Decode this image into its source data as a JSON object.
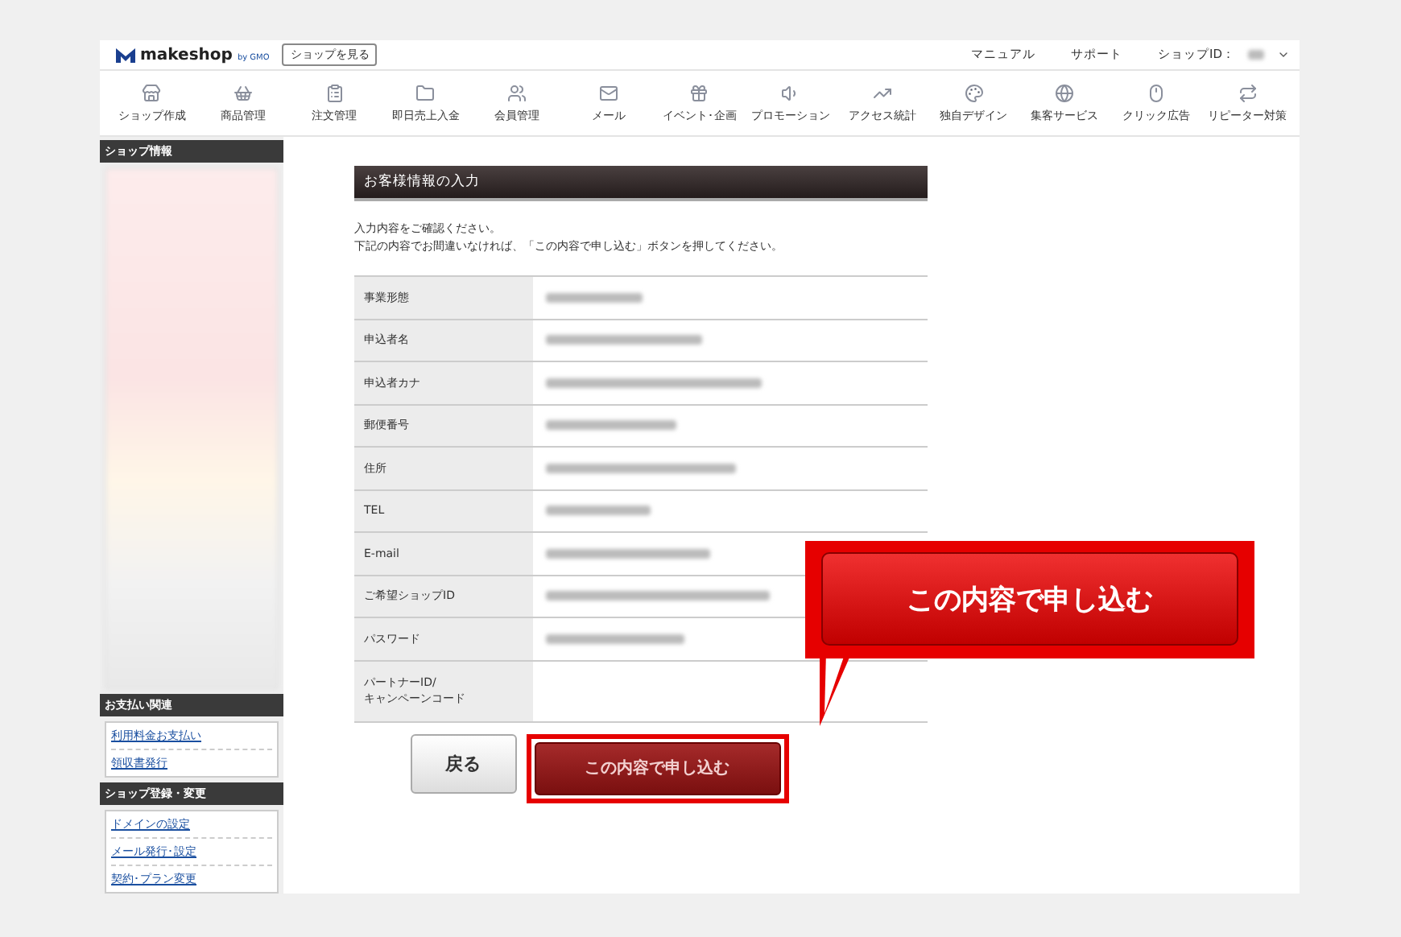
{
  "header": {
    "logo": "makeshop",
    "logo_sub": "by GMO",
    "view_shop": "ショップを見る",
    "links": [
      "マニュアル",
      "サポート"
    ],
    "shop_id_label": "ショップID："
  },
  "nav": [
    {
      "label": "ショップ作成"
    },
    {
      "label": "商品管理"
    },
    {
      "label": "注文管理"
    },
    {
      "label": "即日売上入金"
    },
    {
      "label": "会員管理"
    },
    {
      "label": "メール"
    },
    {
      "label": "イベント･企画"
    },
    {
      "label": "プロモーション"
    },
    {
      "label": "アクセス統計"
    },
    {
      "label": "独自デザイン"
    },
    {
      "label": "集客サービス"
    },
    {
      "label": "クリック広告"
    },
    {
      "label": "リピーター対策"
    }
  ],
  "sidebar": {
    "info_title": "ショップ情報",
    "sections": [
      {
        "title": "お支払い関連",
        "links": [
          "利用料金お支払い",
          "領収書発行"
        ]
      },
      {
        "title": "ショップ登録・変更",
        "links": [
          "ドメインの設定",
          "メール発行･設定",
          "契約･プラン変更"
        ]
      }
    ]
  },
  "main": {
    "title": "お客様情報の入力",
    "intro": [
      "入力内容をご確認ください。",
      "下記の内容でお間違いなければ、「この内容で申し込む」ボタンを押してください。"
    ],
    "rows": [
      {
        "label": "事業形態",
        "kind": "redacted"
      },
      {
        "label": "申込者名",
        "kind": "redacted"
      },
      {
        "label": "申込者カナ",
        "kind": "redacted"
      },
      {
        "label": "郵便番号",
        "kind": "redacted"
      },
      {
        "label": "住所",
        "kind": "redacted"
      },
      {
        "label": "TEL",
        "kind": "redacted"
      },
      {
        "label": "E-mail",
        "kind": "redacted"
      },
      {
        "label": "ご希望ショップID",
        "kind": "redacted"
      },
      {
        "label": "パスワード",
        "kind": "redacted"
      },
      {
        "label": "パートナーID/\nキャンペーンコード",
        "kind": "empty"
      }
    ],
    "back_button": "戻る",
    "submit_button": "この内容で申し込む"
  },
  "callout": {
    "label": "この内容で申し込む"
  }
}
